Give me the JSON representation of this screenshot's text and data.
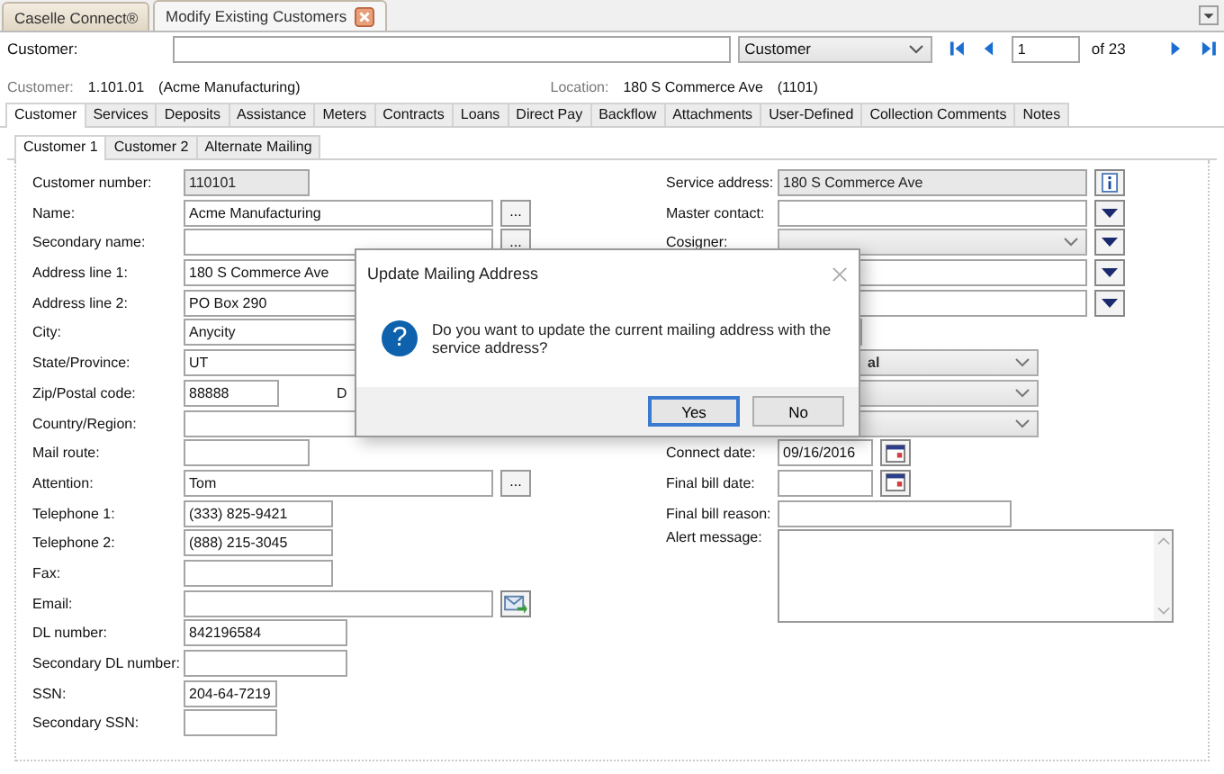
{
  "document_tabs": [
    {
      "label": "Caselle Connect®",
      "selected": false
    },
    {
      "label": "Modify Existing Customers",
      "selected": true
    }
  ],
  "search": {
    "label": "Customer:",
    "lookup_type": "Customer",
    "page": "1",
    "page_total": "of 23"
  },
  "info": {
    "customer_label": "Customer:",
    "customer_number": "1.101.01",
    "customer_name": "(Acme Manufacturing)",
    "location_label": "Location:",
    "location_address": "180 S Commerce Ave",
    "location_number": "(1101)"
  },
  "tabs": [
    {
      "label": "Customer",
      "selected": true
    },
    {
      "label": "Services",
      "selected": false
    },
    {
      "label": "Deposits",
      "selected": false
    },
    {
      "label": "Assistance",
      "selected": false
    },
    {
      "label": "Meters",
      "selected": false
    },
    {
      "label": "Contracts",
      "selected": false
    },
    {
      "label": "Loans",
      "selected": false
    },
    {
      "label": "Direct Pay",
      "selected": false
    },
    {
      "label": "Backflow",
      "selected": false
    },
    {
      "label": "Attachments",
      "selected": false
    },
    {
      "label": "User-Defined",
      "selected": false
    },
    {
      "label": "Collection Comments",
      "selected": false
    },
    {
      "label": "Notes",
      "selected": false
    }
  ],
  "subtabs": [
    {
      "label": "Customer 1",
      "selected": true
    },
    {
      "label": "Customer 2",
      "selected": false
    },
    {
      "label": "Alternate Mailing",
      "selected": false
    }
  ],
  "left_fields": [
    {
      "label": "Customer number:",
      "value": "110101",
      "kind": "readonly"
    },
    {
      "label": "Name:",
      "value": "Acme Manufacturing",
      "kind": "lookup",
      "button": "..."
    },
    {
      "label": "Secondary name:",
      "kind": "lookup",
      "button": "..."
    },
    {
      "label": "Address line 1:",
      "value": "180 S Commerce Ave",
      "kind": "text"
    },
    {
      "label": "Address line 2:",
      "value": "PO Box 290",
      "kind": "text"
    },
    {
      "label": "City:",
      "value": "Anycity",
      "kind": "text"
    },
    {
      "label": "State/Province:",
      "value": "UT",
      "kind": "text"
    },
    {
      "label": "Zip/Postal code:",
      "value": "88888",
      "kind": "zip",
      "extra_label": "D"
    },
    {
      "label": "Country/Region:",
      "kind": "text"
    },
    {
      "label": "Mail route:",
      "kind": "route"
    },
    {
      "label": "Attention:",
      "value": "Tom",
      "kind": "lookup",
      "button": "..."
    },
    {
      "label": "Telephone 1:",
      "value": "(333) 825-9421",
      "kind": "phone"
    },
    {
      "label": "Telephone 2:",
      "value": "(888) 215-3045",
      "kind": "phone"
    },
    {
      "label": "Fax:",
      "kind": "phone"
    },
    {
      "label": "Email:",
      "kind": "email"
    },
    {
      "label": "DL number:",
      "value": "842196584",
      "kind": "id"
    },
    {
      "label": "Secondary DL number:",
      "kind": "id"
    },
    {
      "label": "SSN:",
      "value": "204-64-7219",
      "kind": "ssn"
    },
    {
      "label": "Secondary SSN:",
      "kind": "ssn"
    }
  ],
  "right_fields": [
    {
      "label": "Service address:",
      "value": "180 S Commerce Ave",
      "kind": "readonly_info"
    },
    {
      "label": "Master contact:",
      "kind": "dropdown_text"
    },
    {
      "label": "Cosigner:",
      "kind": "combo_dropdown"
    },
    {
      "kind": "dropdown_text"
    },
    {
      "kind": "dropdown_text"
    },
    {
      "kind": "small_combo"
    },
    {
      "value": "al",
      "kind": "combo_cut"
    },
    {
      "kind": "combo"
    },
    {
      "kind": "combo"
    },
    {
      "label": "Connect date:",
      "value": "09/16/2016",
      "kind": "date"
    },
    {
      "label": "Final bill date:",
      "kind": "date"
    },
    {
      "label": "Final bill reason:",
      "kind": "reason"
    },
    {
      "label": "Alert message:",
      "kind": "memo"
    }
  ],
  "dialog": {
    "title": "Update Mailing Address",
    "icon_glyph": "?",
    "message": "Do you want to update the current mailing address with the service address?",
    "buttons": [
      {
        "label": "Yes",
        "selected": true
      },
      {
        "label": "No",
        "selected": false
      }
    ]
  }
}
